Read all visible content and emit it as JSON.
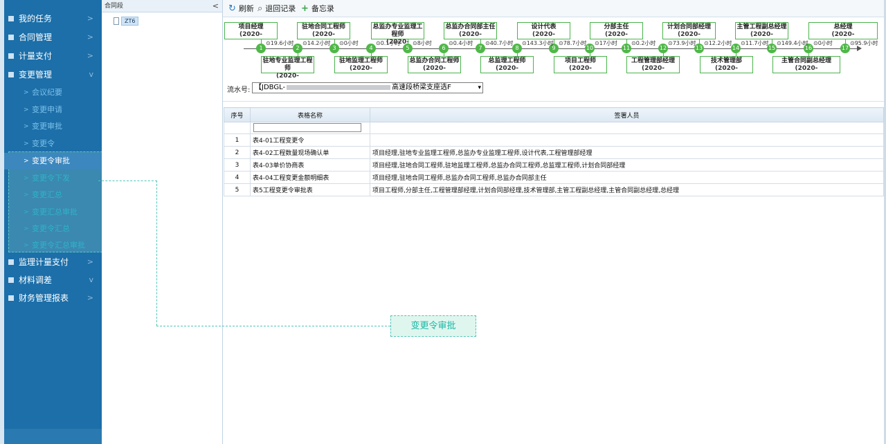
{
  "sidebar": {
    "menu": [
      {
        "label": "我的任务",
        "expanded": false
      },
      {
        "label": "合同管理",
        "expanded": false
      },
      {
        "label": "计量支付",
        "expanded": false
      },
      {
        "label": "变更管理",
        "expanded": true
      },
      {
        "label": "监理计量支付",
        "expanded": false
      },
      {
        "label": "材料调差",
        "expanded": true
      },
      {
        "label": "财务管理报表",
        "expanded": false
      }
    ],
    "change_submenu": [
      "会议纪要",
      "变更申请",
      "变更审批",
      "变更令",
      "变更令审批",
      "变更令下发",
      "变更汇总",
      "变更汇总审批",
      "变更令汇总",
      "变更令汇总审批"
    ],
    "active_item": "变更令审批"
  },
  "tree": {
    "header": "合同段",
    "node": "ZT6"
  },
  "toolbar": {
    "refresh": "刷新",
    "return_records": "退回记录",
    "memo": "备忘录"
  },
  "workflow": {
    "top_roles": [
      {
        "title": "项目经理",
        "date": "(2020-"
      },
      {
        "title": "驻地合同工程师",
        "date": "(2020-"
      },
      {
        "title": "总监办专业监理工程师",
        "date": "(2020-"
      },
      {
        "title": "总监办合同部主任",
        "date": "(2020-"
      },
      {
        "title": "设计代表",
        "date": "(2020-"
      },
      {
        "title": "分部主任",
        "date": "(2020-"
      },
      {
        "title": "计划合同部经理",
        "date": "(2020-"
      },
      {
        "title": "主管工程副总经理",
        "date": "(2020-"
      },
      {
        "title": "总经理",
        "date": "(2020-"
      }
    ],
    "bottom_roles": [
      {
        "title": "驻地专业监理工程师",
        "date": "(2020-"
      },
      {
        "title": "驻地监理工程师",
        "date": "(2020-"
      },
      {
        "title": "总监办合同工程师",
        "date": "(2020-"
      },
      {
        "title": "总监理工程师",
        "date": "(2020-"
      },
      {
        "title": "项目工程师",
        "date": "(2020-"
      },
      {
        "title": "工程管理部经理",
        "date": "(2020-"
      },
      {
        "title": "技术管理部",
        "date": "(2020-"
      },
      {
        "title": "主管合同副总经理",
        "date": "(2020-"
      }
    ],
    "steps": [
      "1",
      "2",
      "3",
      "4",
      "5",
      "6",
      "7",
      "8",
      "9",
      "10",
      "11",
      "12",
      "13",
      "14",
      "15",
      "16",
      "17"
    ],
    "durations": [
      "19.6小时",
      "14.2小时",
      "0小时",
      "0.1小时",
      "8小时",
      "0.4小时",
      "40.7小时",
      "143.3小时",
      "78.7小时",
      "17小时",
      "0.2小时",
      "73.9小时",
      "12.2小时",
      "11.7小时",
      "149.4小时",
      "0小时",
      "95.9小时"
    ]
  },
  "serial": {
    "label": "流水号:",
    "prefix": "【JDBGL-",
    "suffix": "高速段桥梁支座选F"
  },
  "table": {
    "headers": [
      "序号",
      "表格名称",
      "签署人员"
    ],
    "rows": [
      {
        "no": "1",
        "name": "表4-01工程变更令",
        "signers": ""
      },
      {
        "no": "2",
        "name": "表4-02工程数量现场确认单",
        "signers": "项目经理,驻地专业监理工程师,总监办专业监理工程师,设计代表,工程管理部经理"
      },
      {
        "no": "3",
        "name": "表4-03单价协商表",
        "signers": "项目经理,驻地合同工程师,驻地监理工程师,总监办合同工程师,总监理工程师,计划合同部经理"
      },
      {
        "no": "4",
        "name": "表4-04工程变更金额明细表",
        "signers": "项目经理,驻地合同工程师,总监办合同工程师,总监办合同部主任"
      },
      {
        "no": "5",
        "name": "表5工程变更令审批表",
        "signers": "项目工程师,分部主任,工程管理部经理,计划合同部经理,技术管理部,主管工程副总经理,主管合同副总经理,总经理"
      }
    ]
  },
  "callout": {
    "label": "变更令审批"
  },
  "colors": {
    "sidebar_bg": "#1c6fa9",
    "flow_green": "#49b34a",
    "callout_teal": "#19b8a4"
  }
}
